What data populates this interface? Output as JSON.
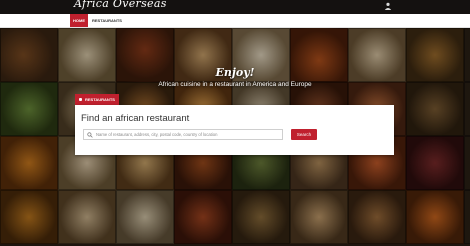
{
  "header": {
    "logo_text": "Africa Overseas"
  },
  "nav": {
    "items": [
      {
        "label": "HOME",
        "active": true
      },
      {
        "label": "RESTAURANTS",
        "active": false
      }
    ]
  },
  "hero": {
    "title": "Enjoy!",
    "subtitle": "African cuisine in a restaurant in America and Europe"
  },
  "search": {
    "tab_label": "RESTAURANTS",
    "heading": "Find an african restaurant",
    "placeholder": "Name of restaurant, address, city, postal code, country of location",
    "button_label": "Search"
  },
  "colors": {
    "accent": "#c0202e",
    "topbar": "#141110",
    "navbar": "#ffffff"
  }
}
